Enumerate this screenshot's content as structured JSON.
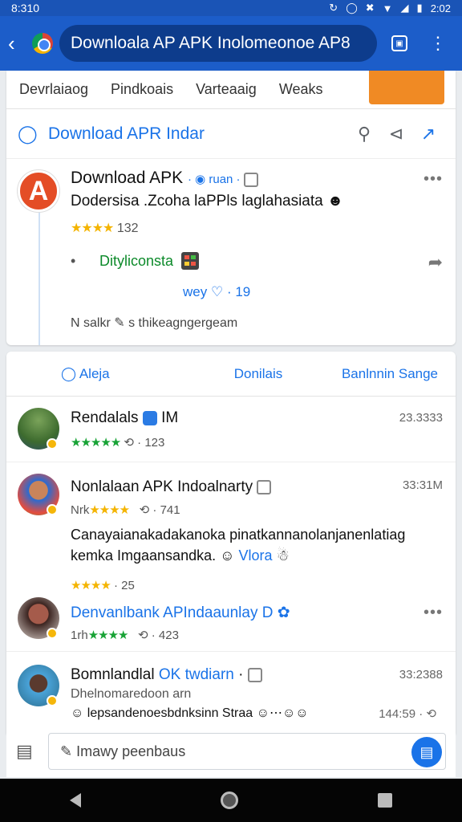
{
  "status": {
    "time": "8:310",
    "clock": "2:02"
  },
  "appbar": {
    "url_text": "Downloala AP APK Inolomeonoe AP8"
  },
  "subnav": [
    "Devrlaiaog",
    "Pindkoais",
    "Varteaaig",
    "Weaks"
  ],
  "header": {
    "title": "Download APR Indar"
  },
  "post": {
    "title": "Download APK",
    "meta": "ruan",
    "description": "Dodersisa .Zcoha laPPls laglahasiata",
    "rating_count": "132",
    "link_text": "Dityliconsta",
    "engage_text": "wey",
    "engage_count": "19",
    "footer": "N salkr",
    "footer_tail": "s thikeagngergeam"
  },
  "tabs": [
    "Aleja",
    "Donilais",
    "Banlnnin Sange"
  ],
  "comments": [
    {
      "name": "Rendalals",
      "tag": "IM",
      "time": "23.3333",
      "rating_count": "123"
    },
    {
      "name": "Nonlalaan APK Indoalnarty",
      "time": "33:31M",
      "rating_prefix": "Nrk",
      "rating_count": "741",
      "text1": "Canayaianakadakanoka pinatkannanolanjanenlatiag",
      "text2": "kemka Imgaansandka.",
      "text2_blue": "Vlora",
      "sub_rating_count": "25"
    },
    {
      "name": "Denvanlbank APIndaaunlay D",
      "rating_prefix": "1rh",
      "rating_count": "423"
    },
    {
      "name": "Bomnlandlal",
      "tag_blue": "OK twdiarn",
      "time": "33:2388",
      "line2": "Dhelnomaredoon arn",
      "line3": "lepsandenoesbdnksinn Straa",
      "line3_count": "144:59"
    }
  ],
  "input": {
    "placeholder": "Imawy peenbaus"
  }
}
